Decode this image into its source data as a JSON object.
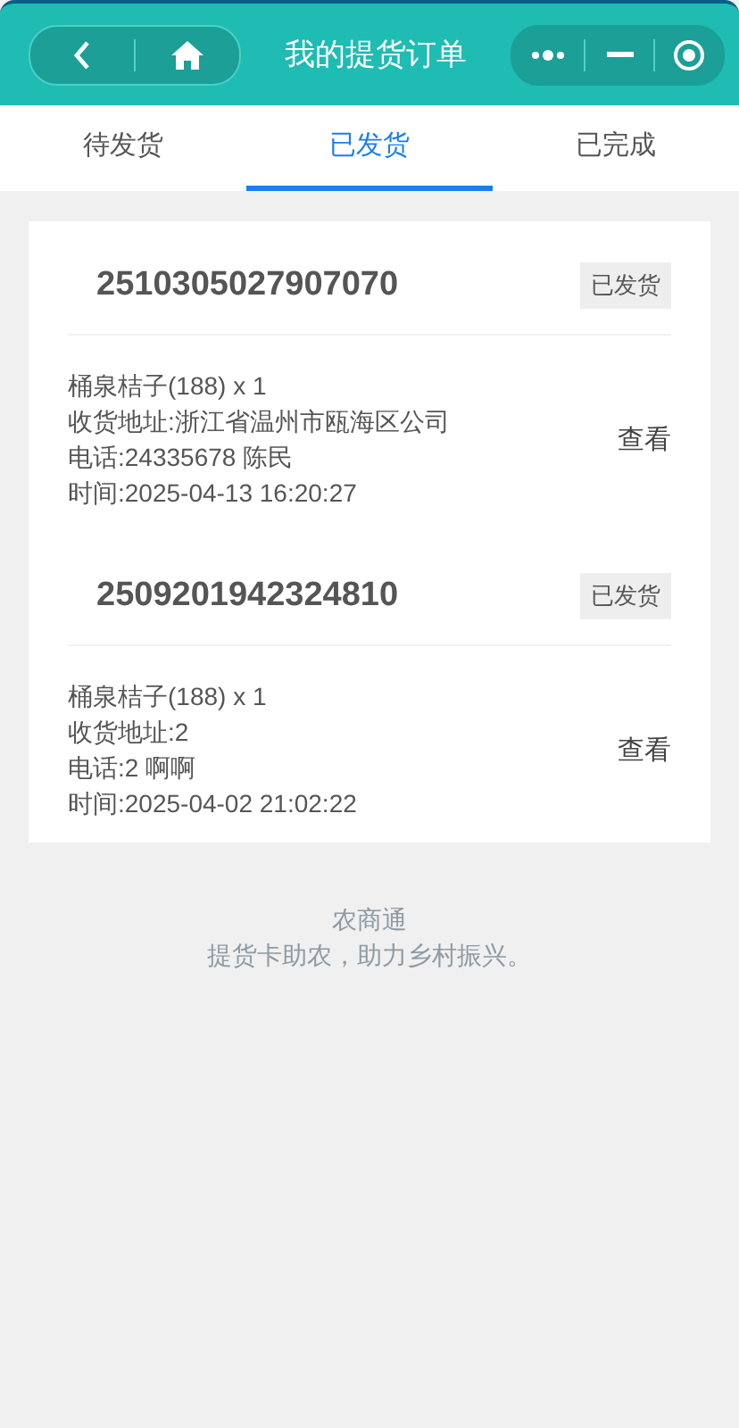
{
  "header": {
    "title": "我的提货订单"
  },
  "tabs": [
    {
      "label": "待发货",
      "selected": false
    },
    {
      "label": "已发货",
      "selected": true
    },
    {
      "label": "已完成",
      "selected": false
    }
  ],
  "orders": [
    {
      "number": "2510305027907070",
      "status": "已发货",
      "lines": [
        "桶泉桔子(188) x 1",
        "收货地址:浙江省温州市瓯海区公司",
        "电话:24335678 陈民",
        "时间:2025-04-13 16:20:27"
      ],
      "action": "查看"
    },
    {
      "number": "2509201942324810",
      "status": "已发货",
      "lines": [
        "桶泉桔子(188) x 1",
        "收货地址:2",
        "电话:2 啊啊",
        "时间:2025-04-02 21:02:22"
      ],
      "action": "查看"
    }
  ],
  "footer": {
    "brand": "农商通",
    "slogan": "提货卡助农，助力乡村振兴。"
  }
}
